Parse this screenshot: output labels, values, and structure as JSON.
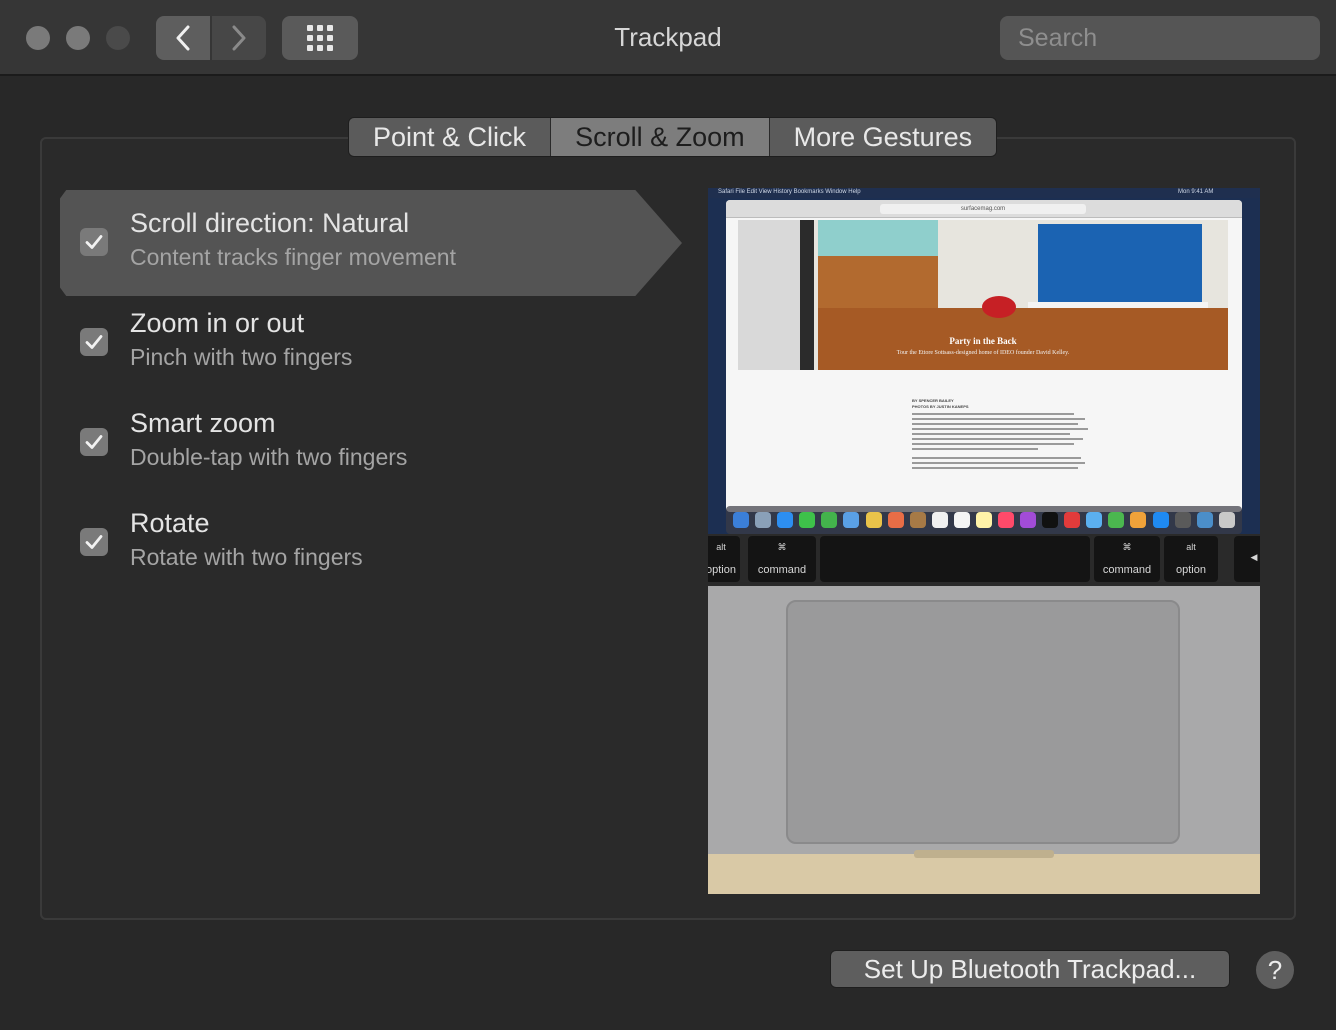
{
  "window": {
    "title": "Trackpad"
  },
  "search": {
    "placeholder": "Search"
  },
  "tabs": [
    {
      "label": "Point & Click",
      "active": false
    },
    {
      "label": "Scroll & Zoom",
      "active": true
    },
    {
      "label": "More Gestures",
      "active": false
    }
  ],
  "options": [
    {
      "title": "Scroll direction: Natural",
      "subtitle": "Content tracks finger movement",
      "checked": true,
      "selected": true
    },
    {
      "title": "Zoom in or out",
      "subtitle": "Pinch with two fingers",
      "checked": true,
      "selected": false
    },
    {
      "title": "Smart zoom",
      "subtitle": "Double-tap with two fingers",
      "checked": true,
      "selected": false
    },
    {
      "title": "Rotate",
      "subtitle": "Rotate with two fingers",
      "checked": true,
      "selected": false
    }
  ],
  "preview": {
    "menubar": "Safari   File   Edit   View   History   Bookmarks   Window   Help",
    "clock": "Mon 9:41 AM",
    "url": "surfacemag.com",
    "hero_title": "Party in the Back",
    "hero_subtitle": "Tour the Ettore Sottsass-designed home of IDEO founder David Kelley.",
    "byline_1": "BY SPENCER BAILEY",
    "byline_2": "PHOTOS BY JUSTIN KANEPS",
    "keys": {
      "left_alt_top": "alt",
      "left_alt_bottom": "option",
      "left_cmd_top": "⌘",
      "left_cmd_bottom": "command",
      "right_cmd_top": "⌘",
      "right_cmd_bottom": "command",
      "right_alt_top": "alt",
      "right_alt_bottom": "option",
      "arrow": "◀"
    }
  },
  "buttons": {
    "setup_bluetooth": "Set Up Bluetooth Trackpad...",
    "help": "?"
  },
  "colors": {
    "background": "#282828",
    "titlebar": "#363636",
    "selected_row": "#545454",
    "checkbox": "#7a7a7a"
  }
}
